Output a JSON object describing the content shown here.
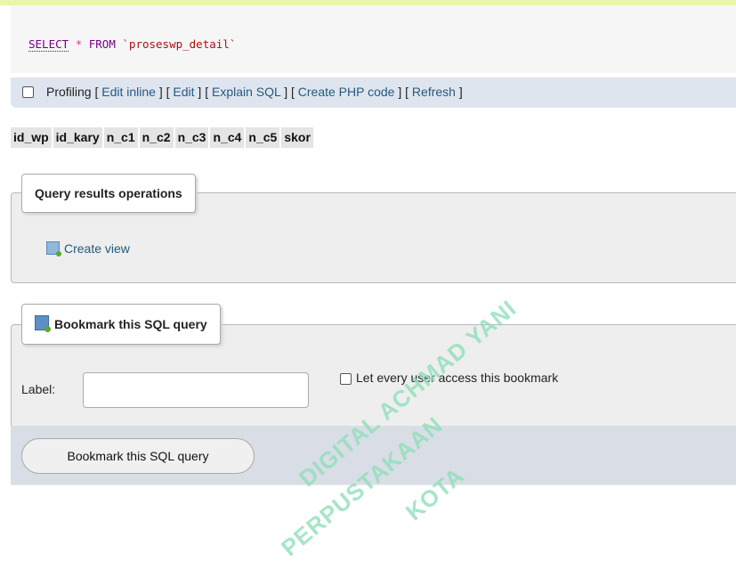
{
  "sql_query": {
    "keyword_select": "SELECT",
    "star": "*",
    "keyword_from": "FROM",
    "table": "`proseswp_detail`"
  },
  "profiling_bar": {
    "profiling_label": "Profiling",
    "links": [
      "Edit inline",
      "Edit",
      "Explain SQL",
      "Create PHP code",
      "Refresh"
    ]
  },
  "table": {
    "columns": [
      "id_wp",
      "id_kary",
      "n_c1",
      "n_c2",
      "n_c3",
      "n_c4",
      "n_c5",
      "skor"
    ]
  },
  "query_results_operations": {
    "legend": "Query results operations",
    "create_view_label": "Create view"
  },
  "bookmark": {
    "legend": "Bookmark this SQL query",
    "label_text": "Label:",
    "label_value": "",
    "share_label": "Let every user access this bookmark",
    "submit_label": "Bookmark this SQL query"
  },
  "watermark": {
    "lines": [
      "PERPUSTAKAAN",
      "DIGITAL ACHMAD YANI",
      "KOTA"
    ]
  },
  "colors": {
    "link": "#235a81",
    "sql_keyword": "#770088",
    "sql_operator": "#e8338a",
    "watermark": "#8fe0b9"
  },
  "icons": {
    "create_view": "create-view-icon",
    "bookmark": "bookmark-icon"
  }
}
